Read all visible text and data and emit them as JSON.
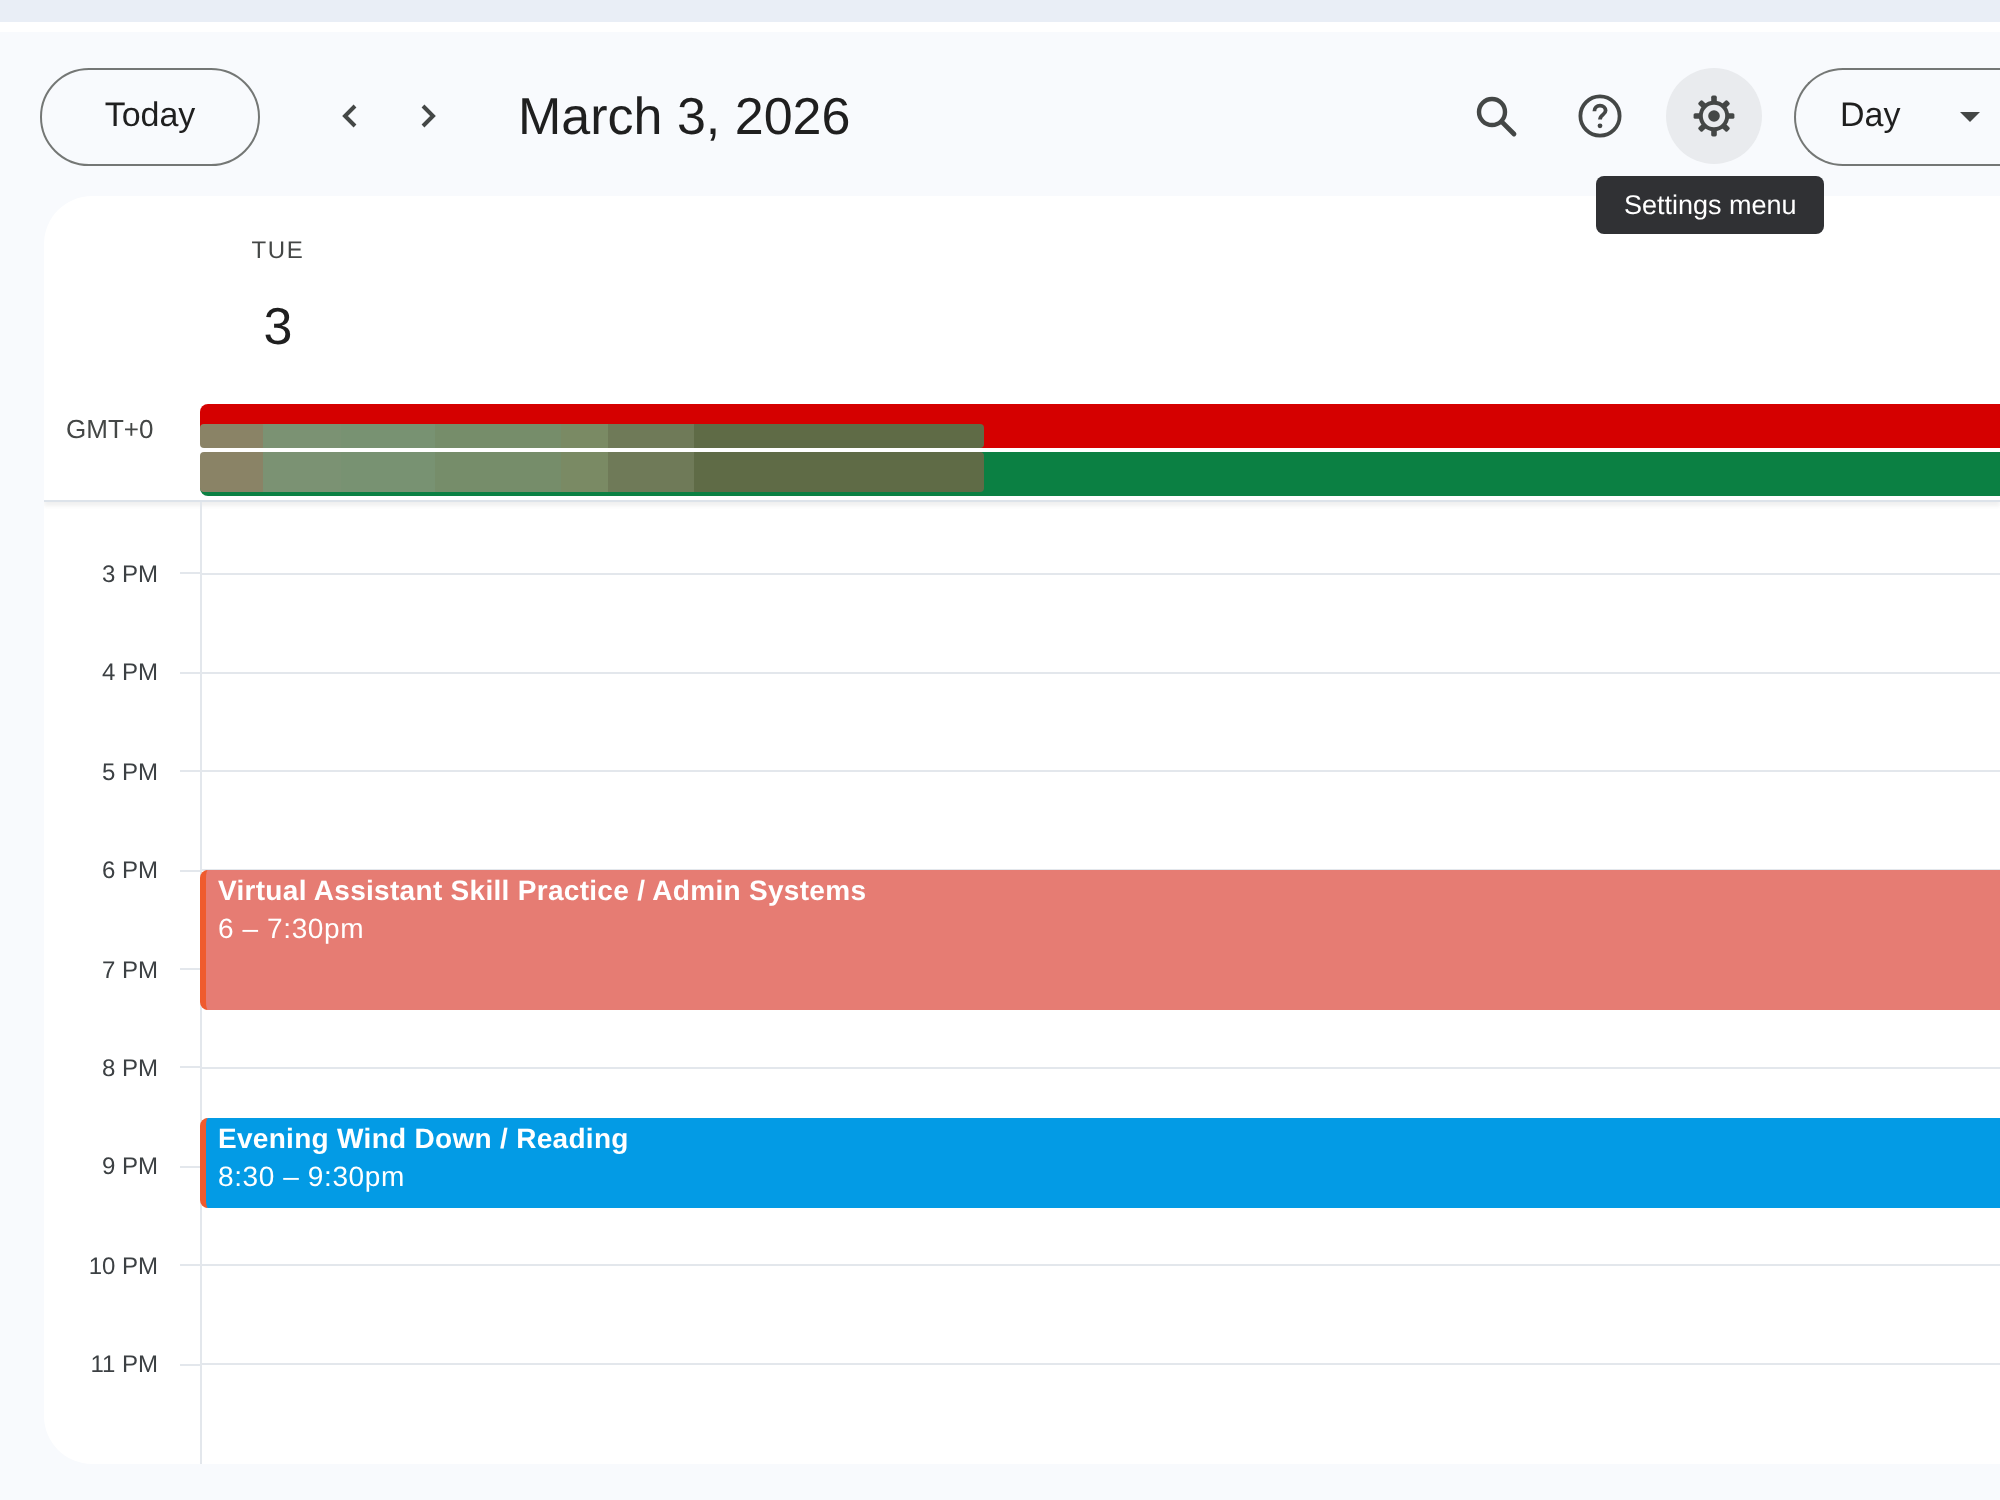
{
  "toolbar": {
    "today_button": "Today",
    "title": "March 3, 2026",
    "settings_hovered": true,
    "view_dropdown": "Day"
  },
  "tooltip": "Settings menu",
  "day_header": {
    "weekday": "TUE",
    "date": "3"
  },
  "timezone": "GMT+0",
  "all_day_events": [
    {
      "color": "#d50000"
    },
    {
      "color": "#0b8043"
    }
  ],
  "hours": [
    "3 PM",
    "4 PM",
    "5 PM",
    "6 PM",
    "7 PM",
    "8 PM",
    "9 PM",
    "10 PM",
    "11 PM"
  ],
  "events": [
    {
      "title": "Virtual Assistant Skill Practice / Admin Systems",
      "time": "6 – 7:30pm",
      "color": "#e67c73"
    },
    {
      "title": "Evening Wind Down / Reading",
      "time": "8:30 – 9:30pm",
      "color": "#039be5"
    }
  ]
}
